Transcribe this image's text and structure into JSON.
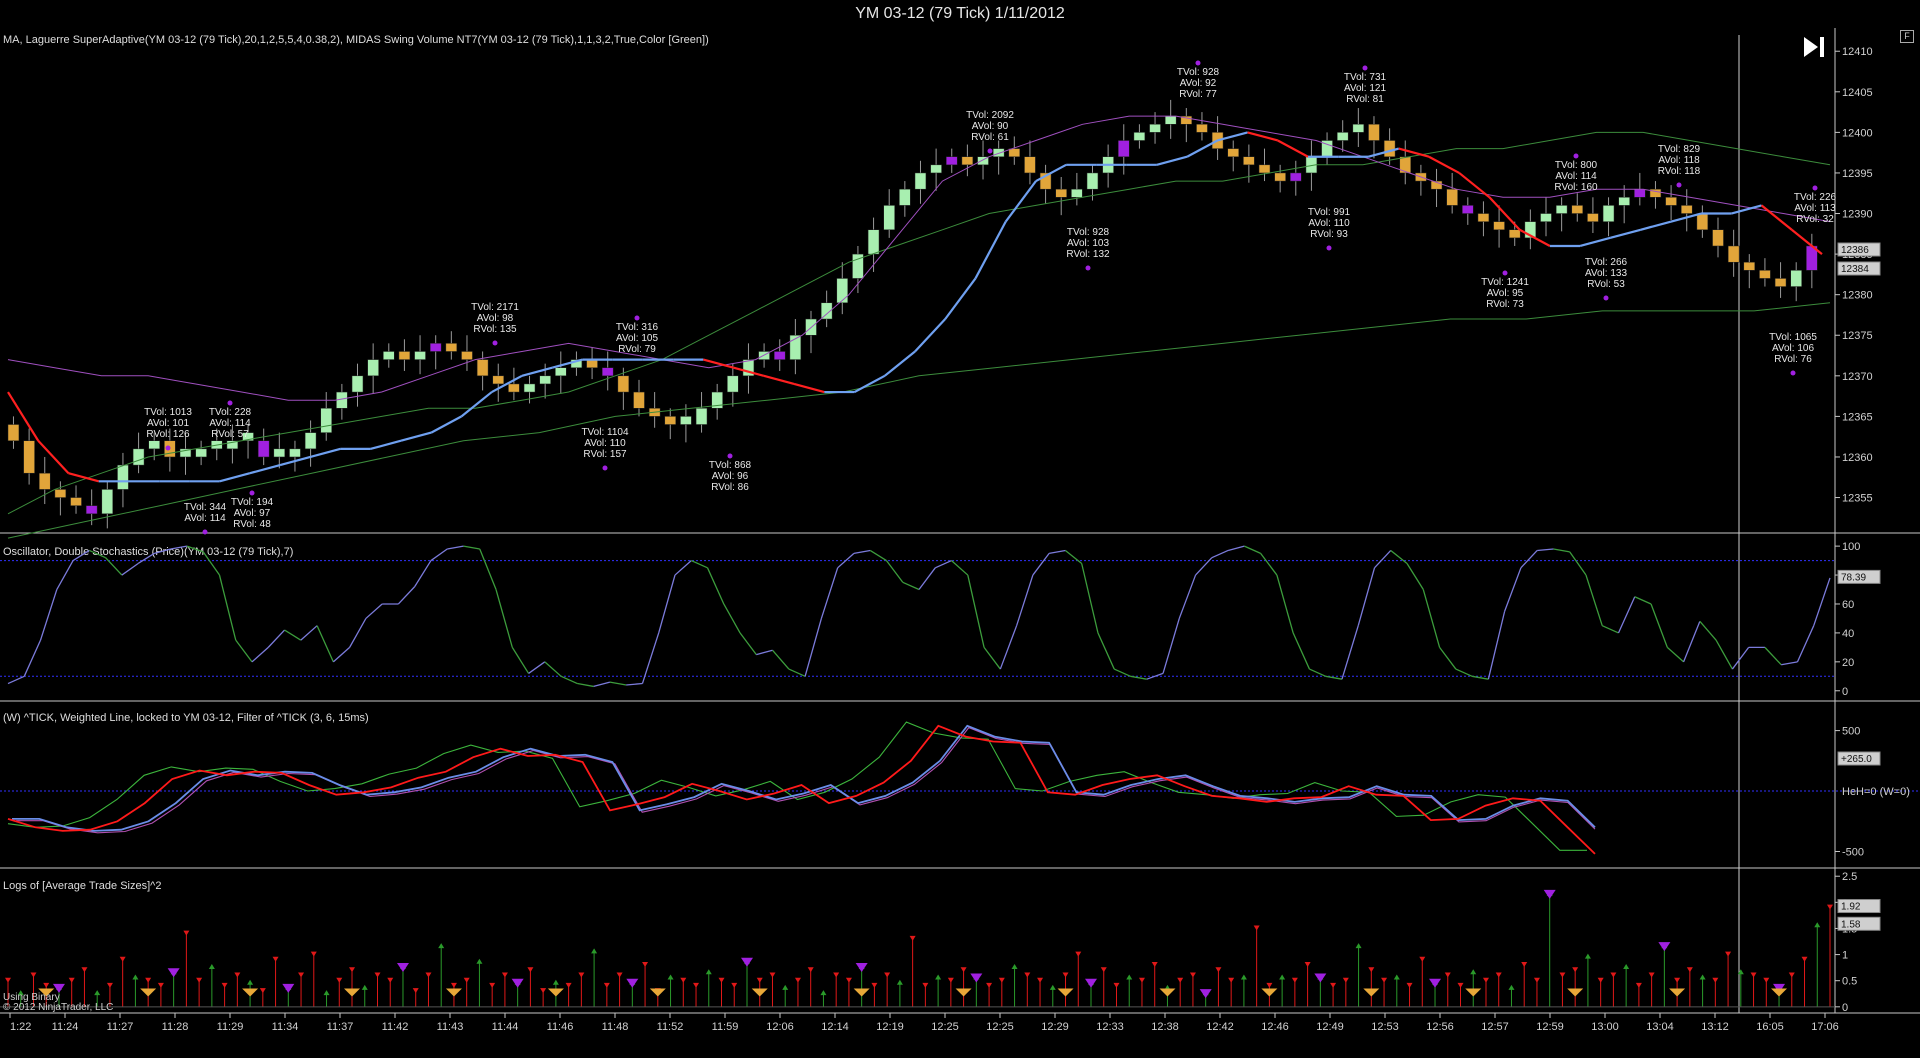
{
  "window": {
    "title": "YM 03-12 (79 Tick)  1/11/2012",
    "corner_button": "F"
  },
  "colors": {
    "bull": "#a8efb0",
    "bear": "#e1a53a",
    "volume_bar": "#a020e0",
    "laguerre_up": "#6fa0f0",
    "laguerre_down": "#ff2020",
    "midas_band": "#a050c0",
    "midas_green": "#3c8c3c",
    "stoch_blue": "#7b7bdb",
    "stoch_green": "#3c9c3c",
    "tick_red": "#ff1a1a",
    "tick_blue": "#6a8de8",
    "tick_green": "#3cb43c",
    "tick_purple": "#b050b0",
    "grid_dotted": "#3030ff",
    "separator": "#d0d0d0"
  },
  "footer": {
    "line1": "Using Binary",
    "line2": "© 2012 NinjaTrader, LLC"
  },
  "x_axis": {
    "labels": [
      "1:22",
      "11:24",
      "11:27",
      "11:28",
      "11:29",
      "11:34",
      "11:37",
      "11:42",
      "11:43",
      "11:44",
      "11:46",
      "11:48",
      "11:52",
      "11:59",
      "12:06",
      "12:14",
      "12:19",
      "12:25",
      "12:25",
      "12:29",
      "12:33",
      "12:38",
      "12:42",
      "12:46",
      "12:49",
      "12:53",
      "12:56",
      "12:57",
      "12:59",
      "13:00",
      "13:04",
      "13:12",
      "16:05",
      "17:06"
    ]
  },
  "chart_data": [
    {
      "type": "candlestick",
      "title": "MA, Laguerre SuperAdaptive(YM 03-12 (79 Tick),20,1,2,5,5,4,0.38,2), MIDAS Swing Volume NT7(YM 03-12 (79 Tick),1,1,3,2,True,Color [Green])",
      "ylim": [
        12351,
        12412
      ],
      "yticks": [
        12355,
        12360,
        12365,
        12370,
        12375,
        12380,
        12385,
        12390,
        12395,
        12400,
        12405,
        12410
      ],
      "last_price_labels": [
        "12386",
        "12384"
      ],
      "closes": [
        12362,
        12358,
        12356,
        12355,
        12354,
        12353,
        12356,
        12359,
        12361,
        12362,
        12360,
        12360,
        12361,
        12361,
        12362,
        12362,
        12360,
        12360,
        12361,
        12363,
        12366,
        12368,
        12370,
        12372,
        12373,
        12372,
        12373,
        12374,
        12373,
        12372,
        12370,
        12369,
        12368,
        12369,
        12370,
        12371,
        12372,
        12371,
        12370,
        12368,
        12366,
        12365,
        12364,
        12364,
        12366,
        12368,
        12370,
        12372,
        12373,
        12372,
        12375,
        12377,
        12379,
        12382,
        12385,
        12388,
        12391,
        12393,
        12395,
        12396,
        12397,
        12396,
        12397,
        12398,
        12397,
        12395,
        12393,
        12392,
        12393,
        12395,
        12397,
        12399,
        12400,
        12401,
        12402,
        12401,
        12400,
        12398,
        12397,
        12396,
        12395,
        12394,
        12395,
        12397,
        12399,
        12400,
        12401,
        12399,
        12397,
        12395,
        12394,
        12393,
        12391,
        12390,
        12389,
        12388,
        12387,
        12389,
        12390,
        12391,
        12390,
        12389,
        12391,
        12392,
        12393,
        12392,
        12391,
        12390,
        12388,
        12386,
        12384,
        12383,
        12382,
        12381,
        12383,
        12386
      ],
      "laguerre": [
        12368,
        12362,
        12358,
        12357,
        12357,
        12357,
        12357,
        12357,
        12358,
        12359,
        12360,
        12361,
        12361,
        12362,
        12363,
        12365,
        12368,
        12370,
        12371,
        12372,
        12372,
        12372,
        12372,
        12372,
        12371,
        12370,
        12369,
        12368,
        12368,
        12370,
        12373,
        12377,
        12382,
        12389,
        12394,
        12396,
        12396,
        12396,
        12396,
        12397,
        12399,
        12400,
        12399,
        12397,
        12397,
        12397,
        12398,
        12397,
        12395,
        12392,
        12388,
        12386,
        12386,
        12387,
        12388,
        12389,
        12390,
        12390,
        12391,
        12388,
        12385
      ],
      "midas_upper": [
        12372,
        12371,
        12370,
        12370,
        12369,
        12368,
        12367,
        12367,
        12368,
        12370,
        12372,
        12373,
        12374,
        12373,
        12372,
        12371,
        12372,
        12375,
        12380,
        12387,
        12394,
        12397,
        12399,
        12401,
        12402,
        12402,
        12401,
        12400,
        12399,
        12397,
        12395,
        12393,
        12392,
        12392,
        12393,
        12393,
        12392,
        12391,
        12390,
        12389
      ],
      "midas_lower": [
        12353,
        12356,
        12358,
        12360,
        12361,
        12362,
        12363,
        12364,
        12365,
        12366,
        12366,
        12367,
        12368,
        12370,
        12372,
        12375,
        12378,
        12381,
        12384,
        12386,
        12388,
        12390,
        12391,
        12392,
        12393,
        12394,
        12394,
        12395,
        12396,
        12396,
        12397,
        12398,
        12398,
        12399,
        12400,
        12400,
        12399,
        12398,
        12397,
        12396
      ],
      "midas_long": [
        12350,
        12352,
        12354,
        12356,
        12358,
        12360,
        12362,
        12363,
        12365,
        12366,
        12367,
        12368,
        12370,
        12371,
        12372,
        12373,
        12374,
        12375,
        12376,
        12377,
        12377,
        12378,
        12378,
        12378,
        12379
      ],
      "annotations": [
        [
          "TVol: 1013",
          "AVol: 101",
          "RVol: 126"
        ],
        [
          "TVol: 228",
          "AVol: 114",
          "RVol: 57"
        ],
        [
          "TVol: 344",
          "AVol: 114"
        ],
        [
          "TVol: 194",
          "AVol: 97",
          "RVol: 48"
        ],
        [
          "TVol: 2171",
          "AVol: 98",
          "RVol: 135"
        ],
        [
          "TVol: 316",
          "AVol: 105",
          "RVol: 79"
        ],
        [
          "TVol: 1104",
          "AVol: 110",
          "RVol: 157"
        ],
        [
          "TVol: 868",
          "AVol: 96",
          "RVol: 86"
        ],
        [
          "TVol: 2092",
          "AVol: 90",
          "RVol: 61"
        ],
        [
          "TVol: 928",
          "AVol: 92",
          "RVol: 77"
        ],
        [
          "TVol: 928",
          "AVol: 103",
          "RVol: 132"
        ],
        [
          "TVol: 731",
          "AVol: 121",
          "RVol: 81"
        ],
        [
          "TVol: 991",
          "AVol: 110",
          "RVol: 93"
        ],
        [
          "TVol: 800",
          "AVol: 114",
          "RVol: 160"
        ],
        [
          "TVol: 829",
          "AVol: 118",
          "RVol: 118"
        ],
        [
          "TVol: 1241",
          "AVol: 95",
          "RVol: 73"
        ],
        [
          "TVol: 266",
          "AVol: 133",
          "RVol: 53"
        ],
        [
          "TVol: 226",
          "AVol: 113",
          "RVol: 32"
        ],
        [
          "TVol: 1065",
          "AVol: 106",
          "RVol: 76"
        ]
      ]
    },
    {
      "type": "line",
      "title": "Oscillator, Double Stochastics (Price)(YM 03-12 (79 Tick),7)",
      "ylim": [
        -5,
        107
      ],
      "yticks": [
        0,
        20,
        40,
        60,
        80,
        100
      ],
      "levels": [
        10,
        90
      ],
      "last_value_label": "78.39",
      "values": [
        5,
        10,
        35,
        70,
        90,
        97,
        92,
        80,
        88,
        95,
        98,
        100,
        96,
        80,
        35,
        20,
        30,
        42,
        35,
        45,
        20,
        30,
        50,
        60,
        60,
        72,
        90,
        98,
        100,
        98,
        70,
        30,
        12,
        20,
        10,
        5,
        3,
        6,
        4,
        5,
        40,
        80,
        90,
        85,
        60,
        40,
        25,
        28,
        15,
        10,
        50,
        85,
        95,
        97,
        90,
        75,
        70,
        85,
        90,
        80,
        30,
        15,
        45,
        80,
        95,
        97,
        88,
        40,
        15,
        10,
        8,
        12,
        50,
        80,
        92,
        97,
        100,
        95,
        80,
        40,
        15,
        10,
        8,
        45,
        85,
        97,
        88,
        70,
        30,
        15,
        10,
        8,
        55,
        85,
        97,
        98,
        96,
        80,
        45,
        40,
        65,
        60,
        30,
        20,
        48,
        35,
        15,
        30,
        30,
        18,
        20,
        45,
        78
      ]
    },
    {
      "type": "line",
      "title": "(W) ^TICK, Weighted Line, locked to YM 03-12, Filter of ^TICK (3, 6, 15ms)",
      "ylim": [
        -620,
        720
      ],
      "yticks": [
        500,
        -500
      ],
      "last_value_label": "+265.0",
      "overlay_label": "HeH=0 (W=0)",
      "series": [
        {
          "name": "",
          "values": [
            -230,
            -300,
            -330,
            -320,
            -250,
            -100,
            100,
            170,
            130,
            160,
            150,
            50,
            -30,
            -10,
            30,
            110,
            160,
            280,
            350,
            290,
            300,
            240,
            -160,
            -110,
            -50,
            60,
            0,
            -70,
            -20,
            50,
            -100,
            -40,
            70,
            250,
            540,
            450,
            410,
            400,
            -10,
            -30,
            50,
            100,
            130,
            40,
            -40,
            -60,
            -90,
            -60,
            -50,
            40,
            -30,
            -40,
            -240,
            -230,
            -120,
            -60,
            -80,
            -300,
            -520
          ]
        }
      ]
    },
    {
      "type": "bar",
      "title": "Logs of [Average Trade Sizes]^2",
      "ylim": [
        -0.08,
        2.6
      ],
      "yticks": [
        0,
        0.5,
        1,
        1.5,
        2,
        2.5
      ],
      "last_value_labels": [
        "1.92",
        "1.58"
      ],
      "values": [
        0.5,
        0.3,
        0.6,
        0.4,
        0.4,
        0.5,
        0.7,
        0.3,
        0.4,
        0.9,
        0.6,
        0.5,
        0.4,
        0.7,
        1.4,
        0.5,
        0.8,
        0.4,
        0.6,
        0.5,
        0.3,
        0.9,
        0.4,
        0.6,
        1.0,
        0.3,
        0.5,
        0.7,
        0.4,
        0.6,
        0.5,
        0.8,
        0.3,
        0.6,
        1.2,
        0.4,
        0.5,
        0.9,
        0.4,
        0.6,
        0.5,
        0.7,
        0.3,
        0.5,
        0.4,
        0.6,
        1.1,
        0.4,
        0.6,
        0.5,
        0.8,
        0.3,
        0.6,
        0.5,
        0.4,
        0.7,
        0.5,
        0.4,
        0.9,
        0.5,
        0.6,
        0.4,
        0.5,
        0.7,
        0.3,
        0.6,
        0.5,
        0.8,
        0.4,
        0.6,
        0.5,
        1.3,
        0.4,
        0.6,
        0.5,
        0.7,
        0.6,
        0.4,
        0.5,
        0.8,
        0.6,
        0.5,
        0.4,
        0.6,
        1.0,
        0.5,
        0.7,
        0.4,
        0.6,
        0.5,
        0.8,
        0.4,
        0.5,
        0.6,
        0.3,
        0.7,
        0.5,
        0.6,
        1.5,
        0.4,
        0.6,
        0.5,
        0.8,
        0.6,
        0.4,
        0.5,
        1.2,
        0.7,
        0.5,
        0.6,
        0.4,
        0.9,
        0.5,
        0.6,
        0.4,
        0.7,
        0.5,
        0.6,
        0.4,
        0.8,
        0.5,
        2.2,
        0.6,
        0.7,
        1.0,
        0.5,
        0.6,
        0.8,
        0.4,
        0.6,
        1.2,
        0.5,
        0.7,
        0.6,
        0.5,
        1.0,
        0.7,
        0.6,
        0.5,
        0.4,
        0.6,
        0.9,
        1.6,
        1.9
      ]
    }
  ]
}
